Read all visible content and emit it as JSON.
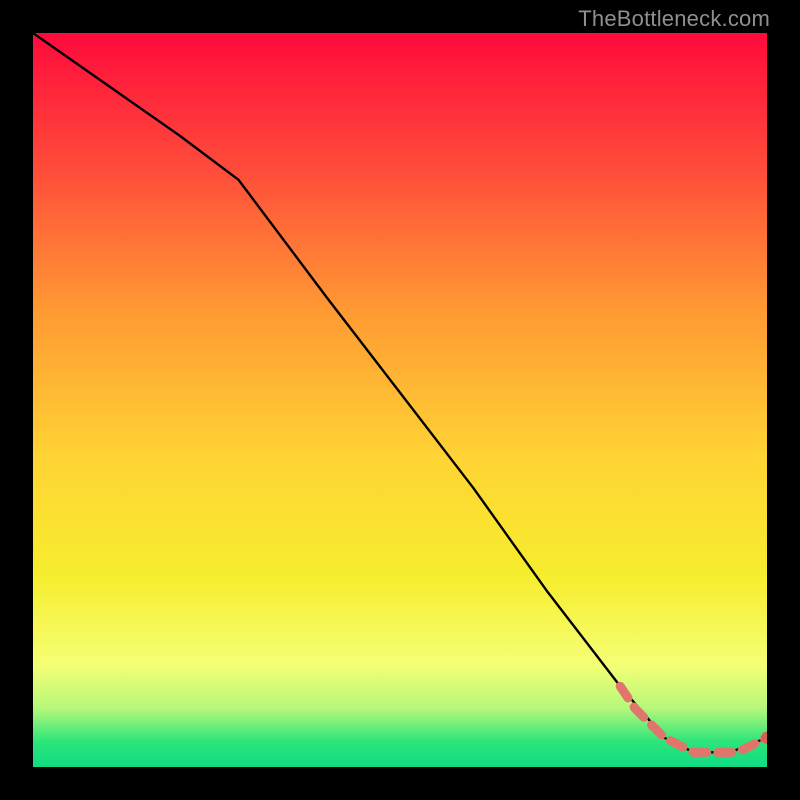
{
  "watermark": "TheBottleneck.com",
  "chart_data": {
    "type": "line",
    "title": "",
    "xlabel": "",
    "ylabel": "",
    "xlim": [
      0,
      100
    ],
    "ylim": [
      0,
      100
    ],
    "grid": false,
    "legend": false,
    "series": [
      {
        "name": "curve",
        "style": "solid-black",
        "x": [
          0,
          10,
          20,
          28,
          40,
          50,
          60,
          70,
          80,
          86,
          90,
          95,
          100
        ],
        "y": [
          100,
          93,
          86,
          80,
          64,
          51,
          38,
          24,
          11,
          4,
          2,
          2,
          4
        ]
      },
      {
        "name": "highlight",
        "style": "dashed-salmon",
        "x": [
          80,
          82,
          84,
          86,
          88,
          90,
          92,
          94,
          96,
          98,
          100
        ],
        "y": [
          11,
          8,
          6,
          4,
          3,
          2,
          2,
          2,
          2,
          3,
          4
        ]
      }
    ],
    "gradient_stops": [
      {
        "pos": 0.0,
        "color": "#ff0a3c"
      },
      {
        "pos": 0.18,
        "color": "#ff4a3a"
      },
      {
        "pos": 0.38,
        "color": "#ff9a33"
      },
      {
        "pos": 0.58,
        "color": "#ffd433"
      },
      {
        "pos": 0.74,
        "color": "#f6ed2e"
      },
      {
        "pos": 0.86,
        "color": "#f5ff74"
      },
      {
        "pos": 0.92,
        "color": "#b6f77a"
      },
      {
        "pos": 0.965,
        "color": "#2de57a"
      },
      {
        "pos": 1.0,
        "color": "#0fdc82"
      }
    ],
    "colors": {
      "curve": "#000000",
      "highlight": "#e0766b",
      "highlight_marker": "#d95f55"
    }
  }
}
